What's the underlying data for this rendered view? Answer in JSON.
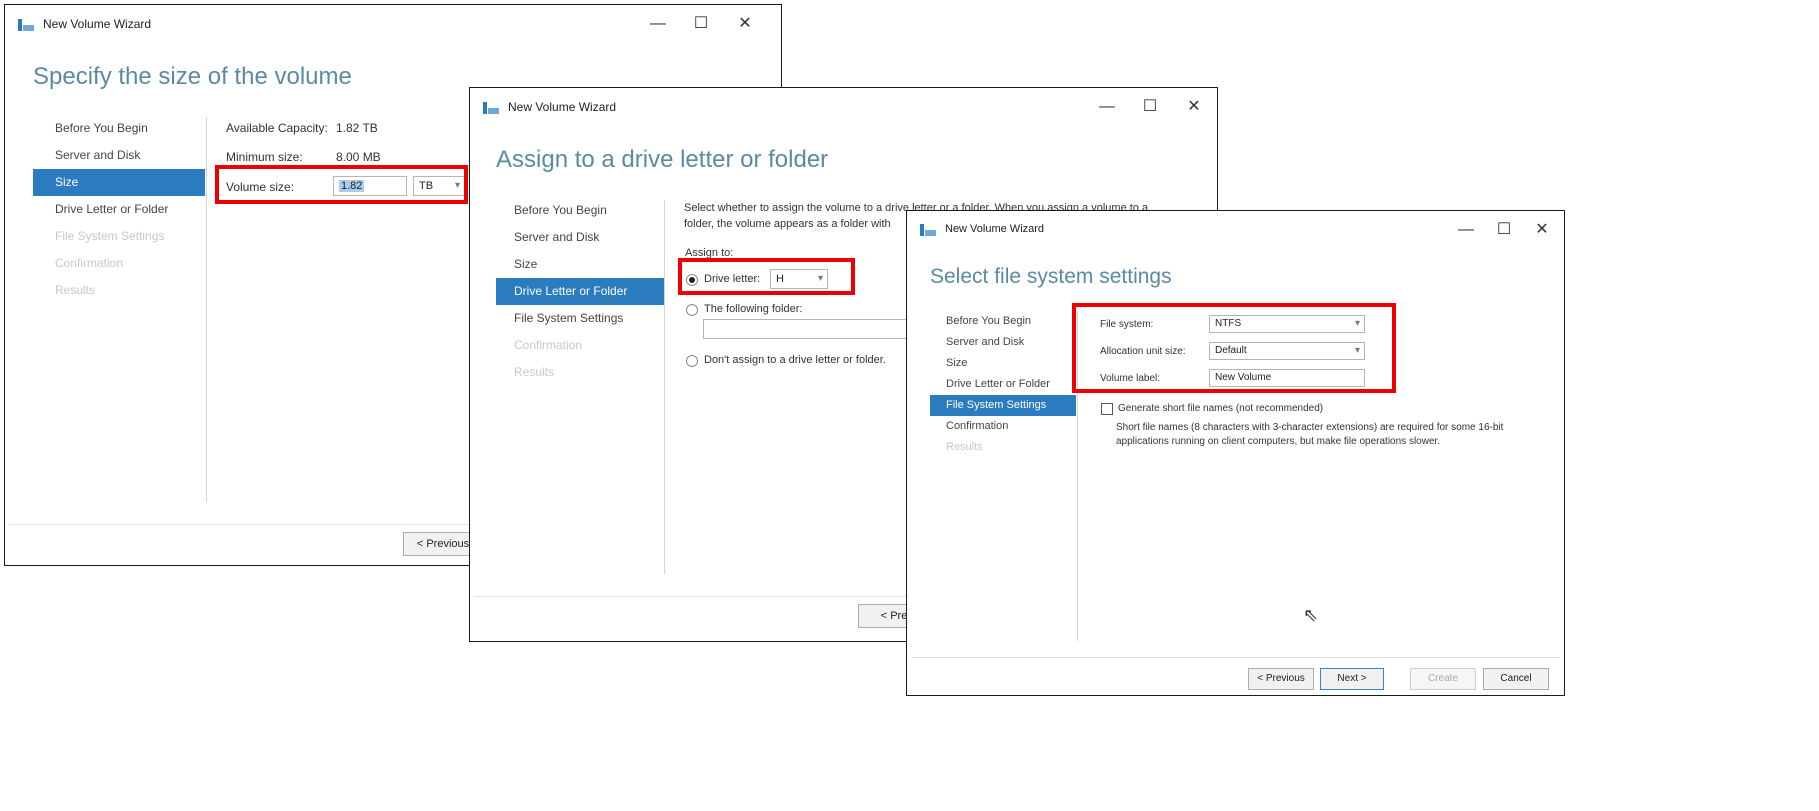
{
  "colors": {
    "accent": "#2b7bbf",
    "heading": "#5b8aa3",
    "highlight": "#ee0000"
  },
  "window_controls": {
    "minimize": "—",
    "maximize": "☐",
    "close": "✕"
  },
  "w1": {
    "title": "New Volume Wizard",
    "heading": "Specify the size of the volume",
    "nav": [
      "Before You Begin",
      "Server and Disk",
      "Size",
      "Drive Letter or Folder",
      "File System Settings",
      "Confirmation",
      "Results"
    ],
    "available_capacity_label": "Available Capacity:",
    "available_capacity_value": "1.82 TB",
    "minimum_size_label": "Minimum size:",
    "minimum_size_value": "8.00 MB",
    "volume_size_label": "Volume size:",
    "volume_size_value": "1.82",
    "unit_value": "TB",
    "previous_button": "< Previous"
  },
  "w2": {
    "title": "New Volume Wizard",
    "heading": "Assign to a drive letter or folder",
    "nav": [
      "Before You Begin",
      "Server and Disk",
      "Size",
      "Drive Letter or Folder",
      "File System Settings",
      "Confirmation",
      "Results"
    ],
    "description_line1": "Select whether to assign the volume to a drive letter or a folder. When you assign a volume to a",
    "description_line2": "folder, the volume appears as a folder with",
    "assign_to_label": "Assign to:",
    "drive_letter_label": "Drive letter:",
    "drive_letter_value": "H",
    "following_folder_label": "The following folder:",
    "dont_assign_label": "Don't assign to a drive letter or folder.",
    "previous_button": "< Previ"
  },
  "w3": {
    "title": "New Volume Wizard",
    "heading": "Select file system settings",
    "nav": [
      "Before You Begin",
      "Server and Disk",
      "Size",
      "Drive Letter or Folder",
      "File System Settings",
      "Confirmation",
      "Results"
    ],
    "file_system_label": "File system:",
    "file_system_value": "NTFS",
    "allocation_label": "Allocation unit size:",
    "allocation_value": "Default",
    "volume_label_label": "Volume label:",
    "volume_label_value": "New Volume",
    "short_names_label": "Generate short file names (not recommended)",
    "short_names_desc1": "Short file names (8 characters with 3-character extensions) are required for some 16-bit",
    "short_names_desc2": "applications running on client computers, but make file operations slower.",
    "buttons": {
      "previous": "< Previous",
      "next": "Next >",
      "create": "Create",
      "cancel": "Cancel"
    }
  }
}
